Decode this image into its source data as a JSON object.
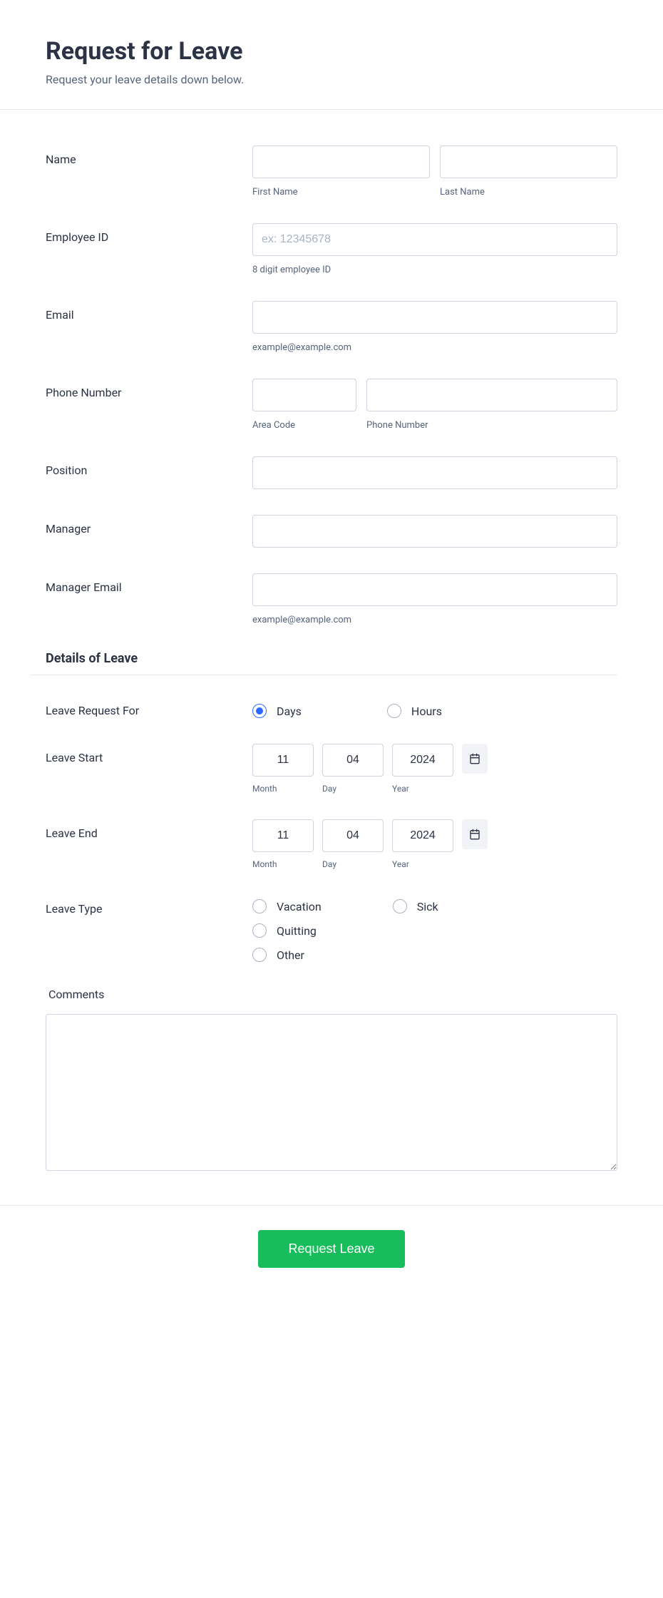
{
  "header": {
    "title": "Request for Leave",
    "subtitle": "Request your leave details down below."
  },
  "fields": {
    "name": {
      "label": "Name",
      "first_sub": "First Name",
      "last_sub": "Last Name"
    },
    "employee_id": {
      "label": "Employee ID",
      "placeholder": "ex: 12345678",
      "sub": "8 digit employee ID"
    },
    "email": {
      "label": "Email",
      "sub": "example@example.com"
    },
    "phone": {
      "label": "Phone Number",
      "area_sub": "Area Code",
      "num_sub": "Phone Number"
    },
    "position": {
      "label": "Position"
    },
    "manager": {
      "label": "Manager"
    },
    "manager_email": {
      "label": "Manager Email",
      "sub": "example@example.com"
    }
  },
  "section": {
    "details_title": "Details of Leave"
  },
  "leave_request_for": {
    "label": "Leave Request For",
    "opt_days": "Days",
    "opt_hours": "Hours",
    "selected": "days"
  },
  "leave_start": {
    "label": "Leave Start",
    "month": "11",
    "day": "04",
    "year": "2024",
    "sub_month": "Month",
    "sub_day": "Day",
    "sub_year": "Year"
  },
  "leave_end": {
    "label": "Leave End",
    "month": "11",
    "day": "04",
    "year": "2024",
    "sub_month": "Month",
    "sub_day": "Day",
    "sub_year": "Year"
  },
  "leave_type": {
    "label": "Leave Type",
    "opt_vacation": "Vacation",
    "opt_sick": "Sick",
    "opt_quitting": "Quitting",
    "opt_other": "Other"
  },
  "comments": {
    "label": "Comments"
  },
  "submit": {
    "label": "Request Leave"
  }
}
